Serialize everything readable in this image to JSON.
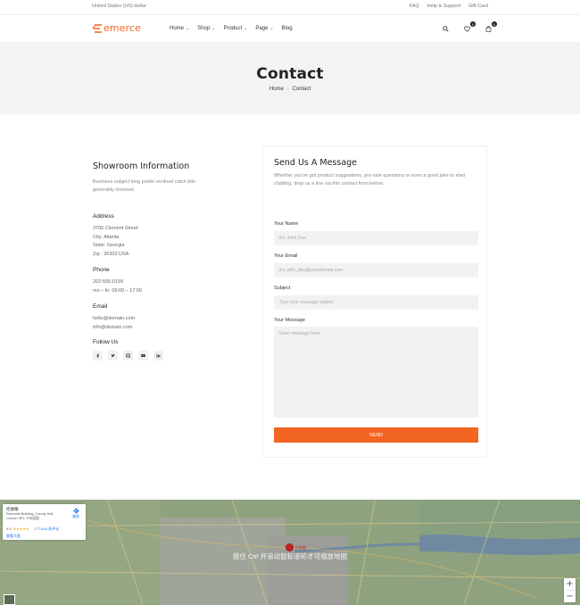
{
  "topbar": {
    "currency": "United States (US) dollar",
    "links": [
      "FAQ",
      "Help & Support",
      "Gift Card"
    ]
  },
  "header": {
    "logo_text": "emerce",
    "nav": [
      {
        "label": "Home",
        "has_dropdown": true
      },
      {
        "label": "Shop",
        "has_dropdown": true
      },
      {
        "label": "Product",
        "has_dropdown": true
      },
      {
        "label": "Page",
        "has_dropdown": true
      },
      {
        "label": "Blog",
        "has_dropdown": false
      }
    ],
    "wishlist_count": "0",
    "cart_count": "0",
    "icons": [
      "search-icon",
      "heart-icon",
      "bag-icon"
    ]
  },
  "hero": {
    "title": "Contact",
    "breadcrumb_home": "Home",
    "breadcrumb_current": "Contact"
  },
  "info": {
    "title": "Showroom Information",
    "description": "Business subject long poetic reclined catch bits generality involved.",
    "address_heading": "Address",
    "address_lines": [
      "3705 Clement Street",
      "City: Atlanta",
      "State: Georgia",
      "Zip : 30303 USA"
    ],
    "phone_heading": "Phone",
    "phone_lines": [
      "202-555-0199",
      "mo – fri: 09:00 – 17:00"
    ],
    "email_heading": "Email",
    "email_lines": [
      "hello@domain.com",
      "info@domain.com"
    ],
    "follow_heading": "Follow Us",
    "socials": [
      "facebook-icon",
      "twitter-icon",
      "instagram-icon",
      "youtube-icon",
      "linkedin-icon"
    ]
  },
  "form": {
    "title": "Send Us A Message",
    "description": "Whether you've got product suggestions, pre-sale questions or even a good joke to start chatting, drop us a line via this contact form below.",
    "name_label": "Your Name",
    "name_placeholder": "Ex: John Doe",
    "email_label": "Your Email",
    "email_placeholder": "Ex: john_doe@yourdomain.com",
    "subject_label": "Subject",
    "subject_placeholder": "Type your message subject",
    "message_label": "Your Message",
    "message_placeholder": "Enter message here.",
    "send_label": "SEND"
  },
  "map": {
    "overlay_text": "按住 Ctrl 并滚动鼠标滚轮才可缩放地图",
    "place_name": "伦敦眼",
    "place_address": "Riverside Building, County Hall, London SE1 7PB英国",
    "rating": "4.5",
    "stars": "★★★★★",
    "reviews": "177,644 条评论",
    "larger_map": "查看大图",
    "directions": "路线",
    "pin_label": "伦敦眼",
    "zoom_in": "+",
    "zoom_out": "−"
  },
  "colors": {
    "accent": "#f26522",
    "hero_bg": "#f3f3f3",
    "field_bg": "#f2f2f2"
  }
}
